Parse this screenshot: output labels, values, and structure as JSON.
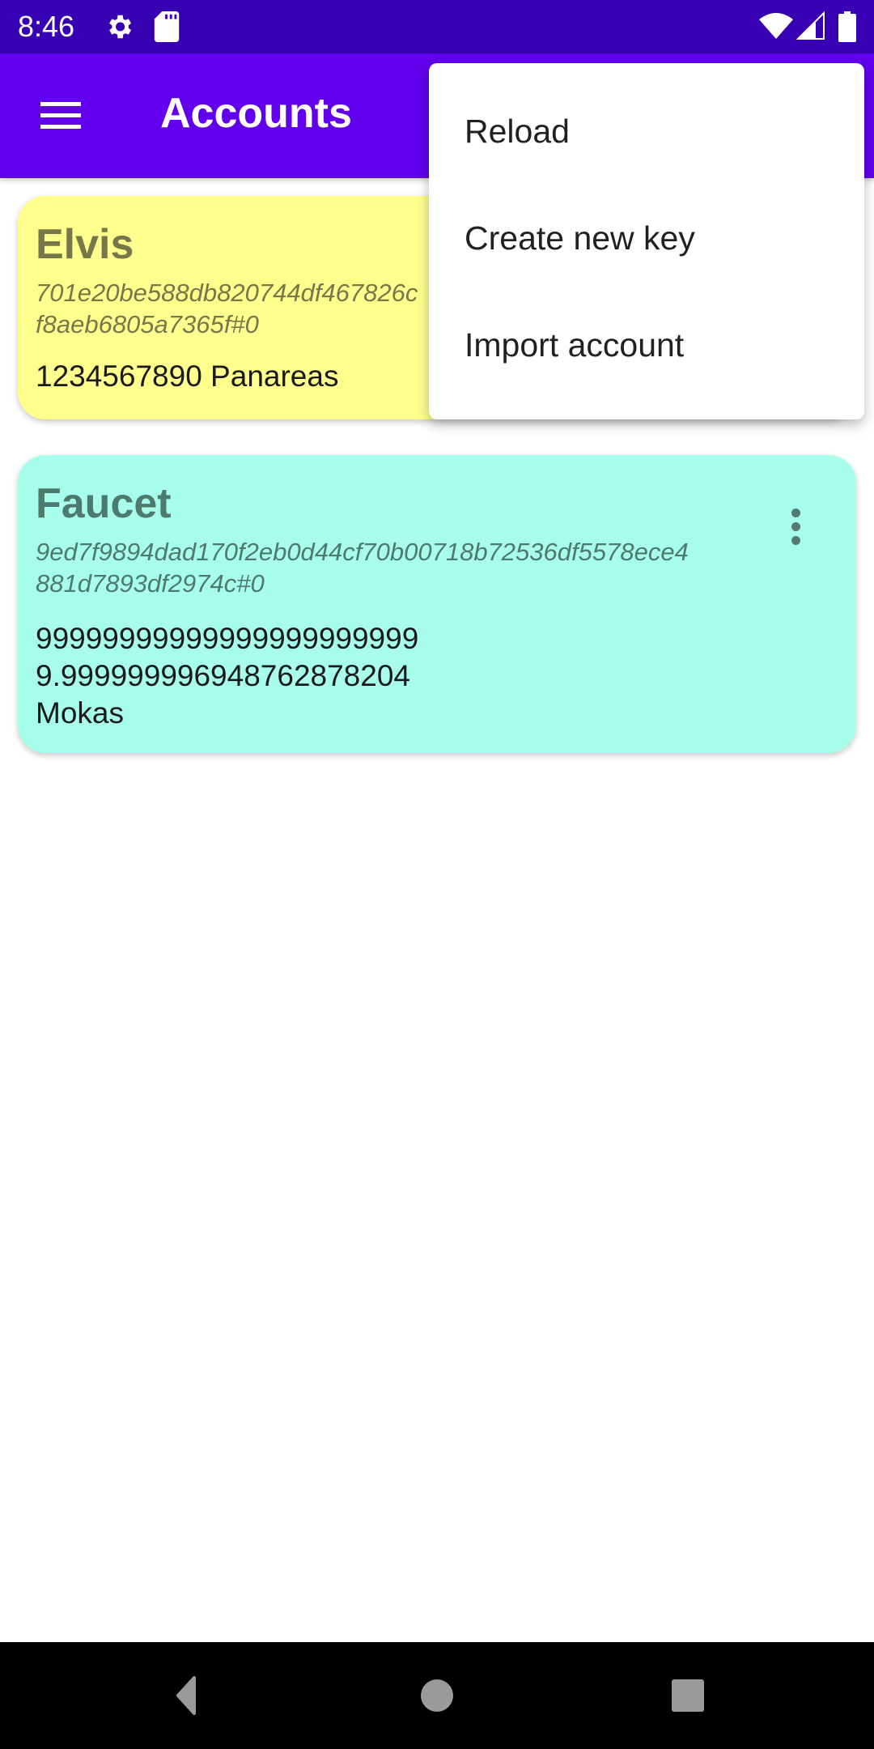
{
  "status_bar": {
    "time": "8:46",
    "left_icons": [
      "gear-icon",
      "sd-card-icon"
    ],
    "right_icons": [
      "wifi-icon",
      "signal-icon",
      "battery-icon"
    ]
  },
  "app_bar": {
    "title": "Accounts",
    "menu_icon": "hamburger-menu-icon"
  },
  "accounts": [
    {
      "name": "Elvis",
      "hash": "701e20be588db820744df467826c… f8aeb6805a7365f#0",
      "hash_line1": "701e20be588db820744df467826c",
      "hash_line2": "f8aeb6805a7365f#0",
      "balance": "1234567890 Panareas",
      "color": "#ffff8d"
    },
    {
      "name": "Faucet",
      "hash_line1": "9ed7f9894dad170f2eb0d44cf70b00718b72536df5578ece4",
      "hash_line2": "881d7893df2974c#0",
      "balance_line1": "99999999999999999999999",
      "balance_line2": "9.999999996948762878204",
      "balance_line3": "Mokas",
      "color": "#a7ffeb",
      "more_icon": "more-vert-icon"
    }
  ],
  "overflow_menu": {
    "items": [
      {
        "label": "Reload"
      },
      {
        "label": "Create new key"
      },
      {
        "label": "Import account"
      }
    ]
  },
  "nav_bar": {
    "buttons": [
      "back",
      "home",
      "recents"
    ]
  },
  "colors": {
    "status_bar": "#3700b3",
    "app_bar": "#6200ee",
    "card_yellow": "#ffff8d",
    "card_teal": "#a7ffeb"
  }
}
